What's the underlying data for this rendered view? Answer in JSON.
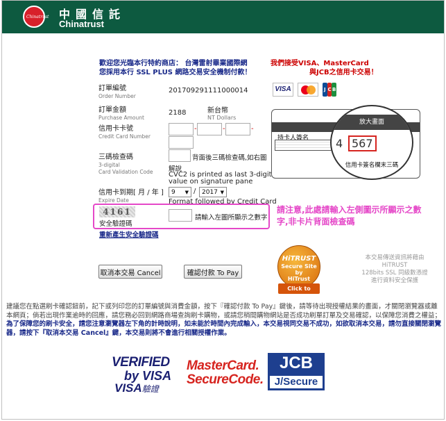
{
  "header": {
    "logo_text": "Chinatrust",
    "brand_cn": "中國信託",
    "brand_en": "Chinatrust"
  },
  "merchant_notice": {
    "line1": "歡迎您光臨本行特約商店： 台灣雷射畢業國際網",
    "line2": "您採用本行 SSL PLUS 網路交易安全機制付款！"
  },
  "accept_notice": {
    "line1": "我們接受VISA、MasterCard",
    "line2": "與JCB之信用卡交易！"
  },
  "card_logos": {
    "visa": "VISA",
    "jcb": [
      "J",
      "C",
      "B"
    ]
  },
  "card_illustration": {
    "magnify_label": "放大畫面",
    "holder_sig": "持卡人簽名",
    "last4_partial": "4",
    "cvv": "567",
    "caption": "信用卡簽名欄末三碼"
  },
  "form": {
    "order_no": {
      "label": "訂單編號",
      "label_en": "Order Number",
      "value": "201709291111000014"
    },
    "amount": {
      "label": "訂單金額",
      "label_en": "Purchase Amount",
      "value": "2188",
      "currency": "新台幣",
      "currency_en": "NT Dollars"
    },
    "card_no": {
      "label": "信用卡卡號",
      "label_en": "Credit Card Number"
    },
    "cvv": {
      "label": "三碼檢查碼",
      "label_en1": "3-digital",
      "label_en2": "Card Validation Code",
      "hint": "背面後三碼檢查碼,如右圖",
      "hint2": "解說",
      "hint_en": "CVC2 is printed as last 3-digit value on signature pane"
    },
    "expiry": {
      "label": "信用卡到期[ 月 / 年 ]",
      "label_en": "Expire Date",
      "month": "9",
      "separator": "/",
      "year": "2017",
      "hint_en": "Format followed by Credit Card"
    },
    "captcha": {
      "image_text": "4161",
      "label": "安全驗證碼",
      "hint": "請輸入左圖所顯示之數字"
    },
    "regen_link": "重新產生安全驗證碼"
  },
  "warning": "請注意,此處請輸入左側圖示所顯示之數字,非卡片背面檢查碼",
  "buttons": {
    "cancel": "取消本交易 Cancel",
    "confirm": "確認付款 To Pay"
  },
  "hitrust": {
    "brand": "HiTRUST",
    "seal1": "Secure Site",
    "seal2": "by",
    "seal3": "HiTrust",
    "click": "Click to verify",
    "note": [
      "本交易傳送資訊將藉由",
      "HiTRUST",
      "128bits SSL 同級數憑證",
      "進行資料安全保護"
    ]
  },
  "disclaimer": {
    "part1": "建議您在點選刷卡確認鈕前，記下或列印您的訂單編號與消費金額，按下『確認付款 To Pay』鍵後，請等待出現授權結果的畫面，才關閉瀏覽器或離本網頁；倘若出現作業逾時的回應，請您務必回到網路商場查詢刷卡購物，或請您稍間購物網站是否成功刷單訂單及交易確認，以保障您消費之權益；",
    "highlight": "為了保障您的刷卡安全，請您注意瀏覽器左下角的計時說明，如未能於時間內完成輸入，本交易視同交易不成功，如欲取消本交易，請勿直接關閉瀏覽器，請按下『取消本交易 Cancel』鍵，本交易則將不會進行相關授權作業。"
  },
  "footer_logos": {
    "vbv1": "VERIFIED",
    "vbv2": "by VISA",
    "vbv3": "VISA",
    "vbv3b": "驗證",
    "mc1": "MasterCard.",
    "mc2": "SecureCode.",
    "jcb1": "JCB",
    "jcb2": "J/Secure"
  },
  "colors": {
    "header_bg": "#0d5a40",
    "accent_red": "#cc0000",
    "warning_magenta": "#e548c8",
    "link_blue": "#1a2a8a"
  }
}
